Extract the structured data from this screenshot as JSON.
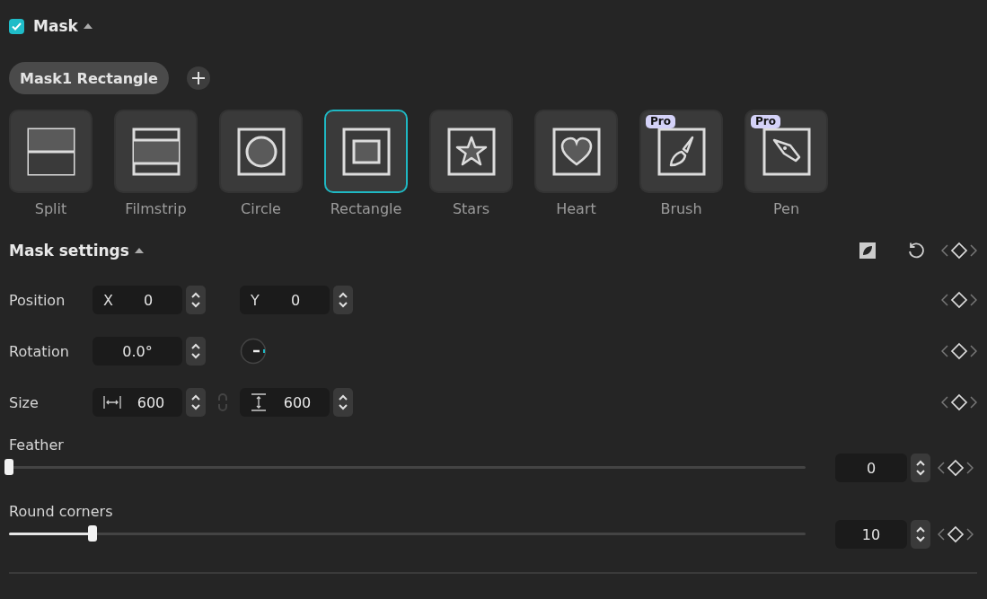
{
  "mask": {
    "title": "Mask",
    "enabled": true,
    "expanded": true
  },
  "chip": {
    "label": "Mask1 Rectangle"
  },
  "shapes": [
    {
      "kind": "split",
      "label": "Split",
      "selected": false
    },
    {
      "kind": "filmstrip",
      "label": "Filmstrip",
      "selected": false
    },
    {
      "kind": "circle",
      "label": "Circle",
      "selected": false
    },
    {
      "kind": "rectangle",
      "label": "Rectangle",
      "selected": true
    },
    {
      "kind": "stars",
      "label": "Stars",
      "selected": false
    },
    {
      "kind": "heart",
      "label": "Heart",
      "selected": false
    },
    {
      "kind": "brush",
      "label": "Brush",
      "selected": false,
      "badge": "Pro"
    },
    {
      "kind": "pen",
      "label": "Pen",
      "selected": false,
      "badge": "Pro"
    }
  ],
  "settings": {
    "title": "Mask settings",
    "expanded": true,
    "rows": [
      {
        "kind": "pair",
        "label": "Position",
        "fields": [
          {
            "prefix": "X",
            "value": "0"
          },
          {
            "prefix": "Y",
            "value": "0"
          }
        ]
      },
      {
        "kind": "rotation",
        "label": "Rotation",
        "fields": [
          {
            "value": "0.0°"
          }
        ]
      },
      {
        "kind": "size",
        "label": "Size",
        "fields": [
          {
            "value": "600"
          },
          {
            "value": "600"
          }
        ]
      }
    ],
    "sliders": [
      {
        "label": "Feather",
        "level": 0,
        "value": "0"
      },
      {
        "label": "Round corners",
        "level": 0.105,
        "value": "10"
      }
    ]
  }
}
